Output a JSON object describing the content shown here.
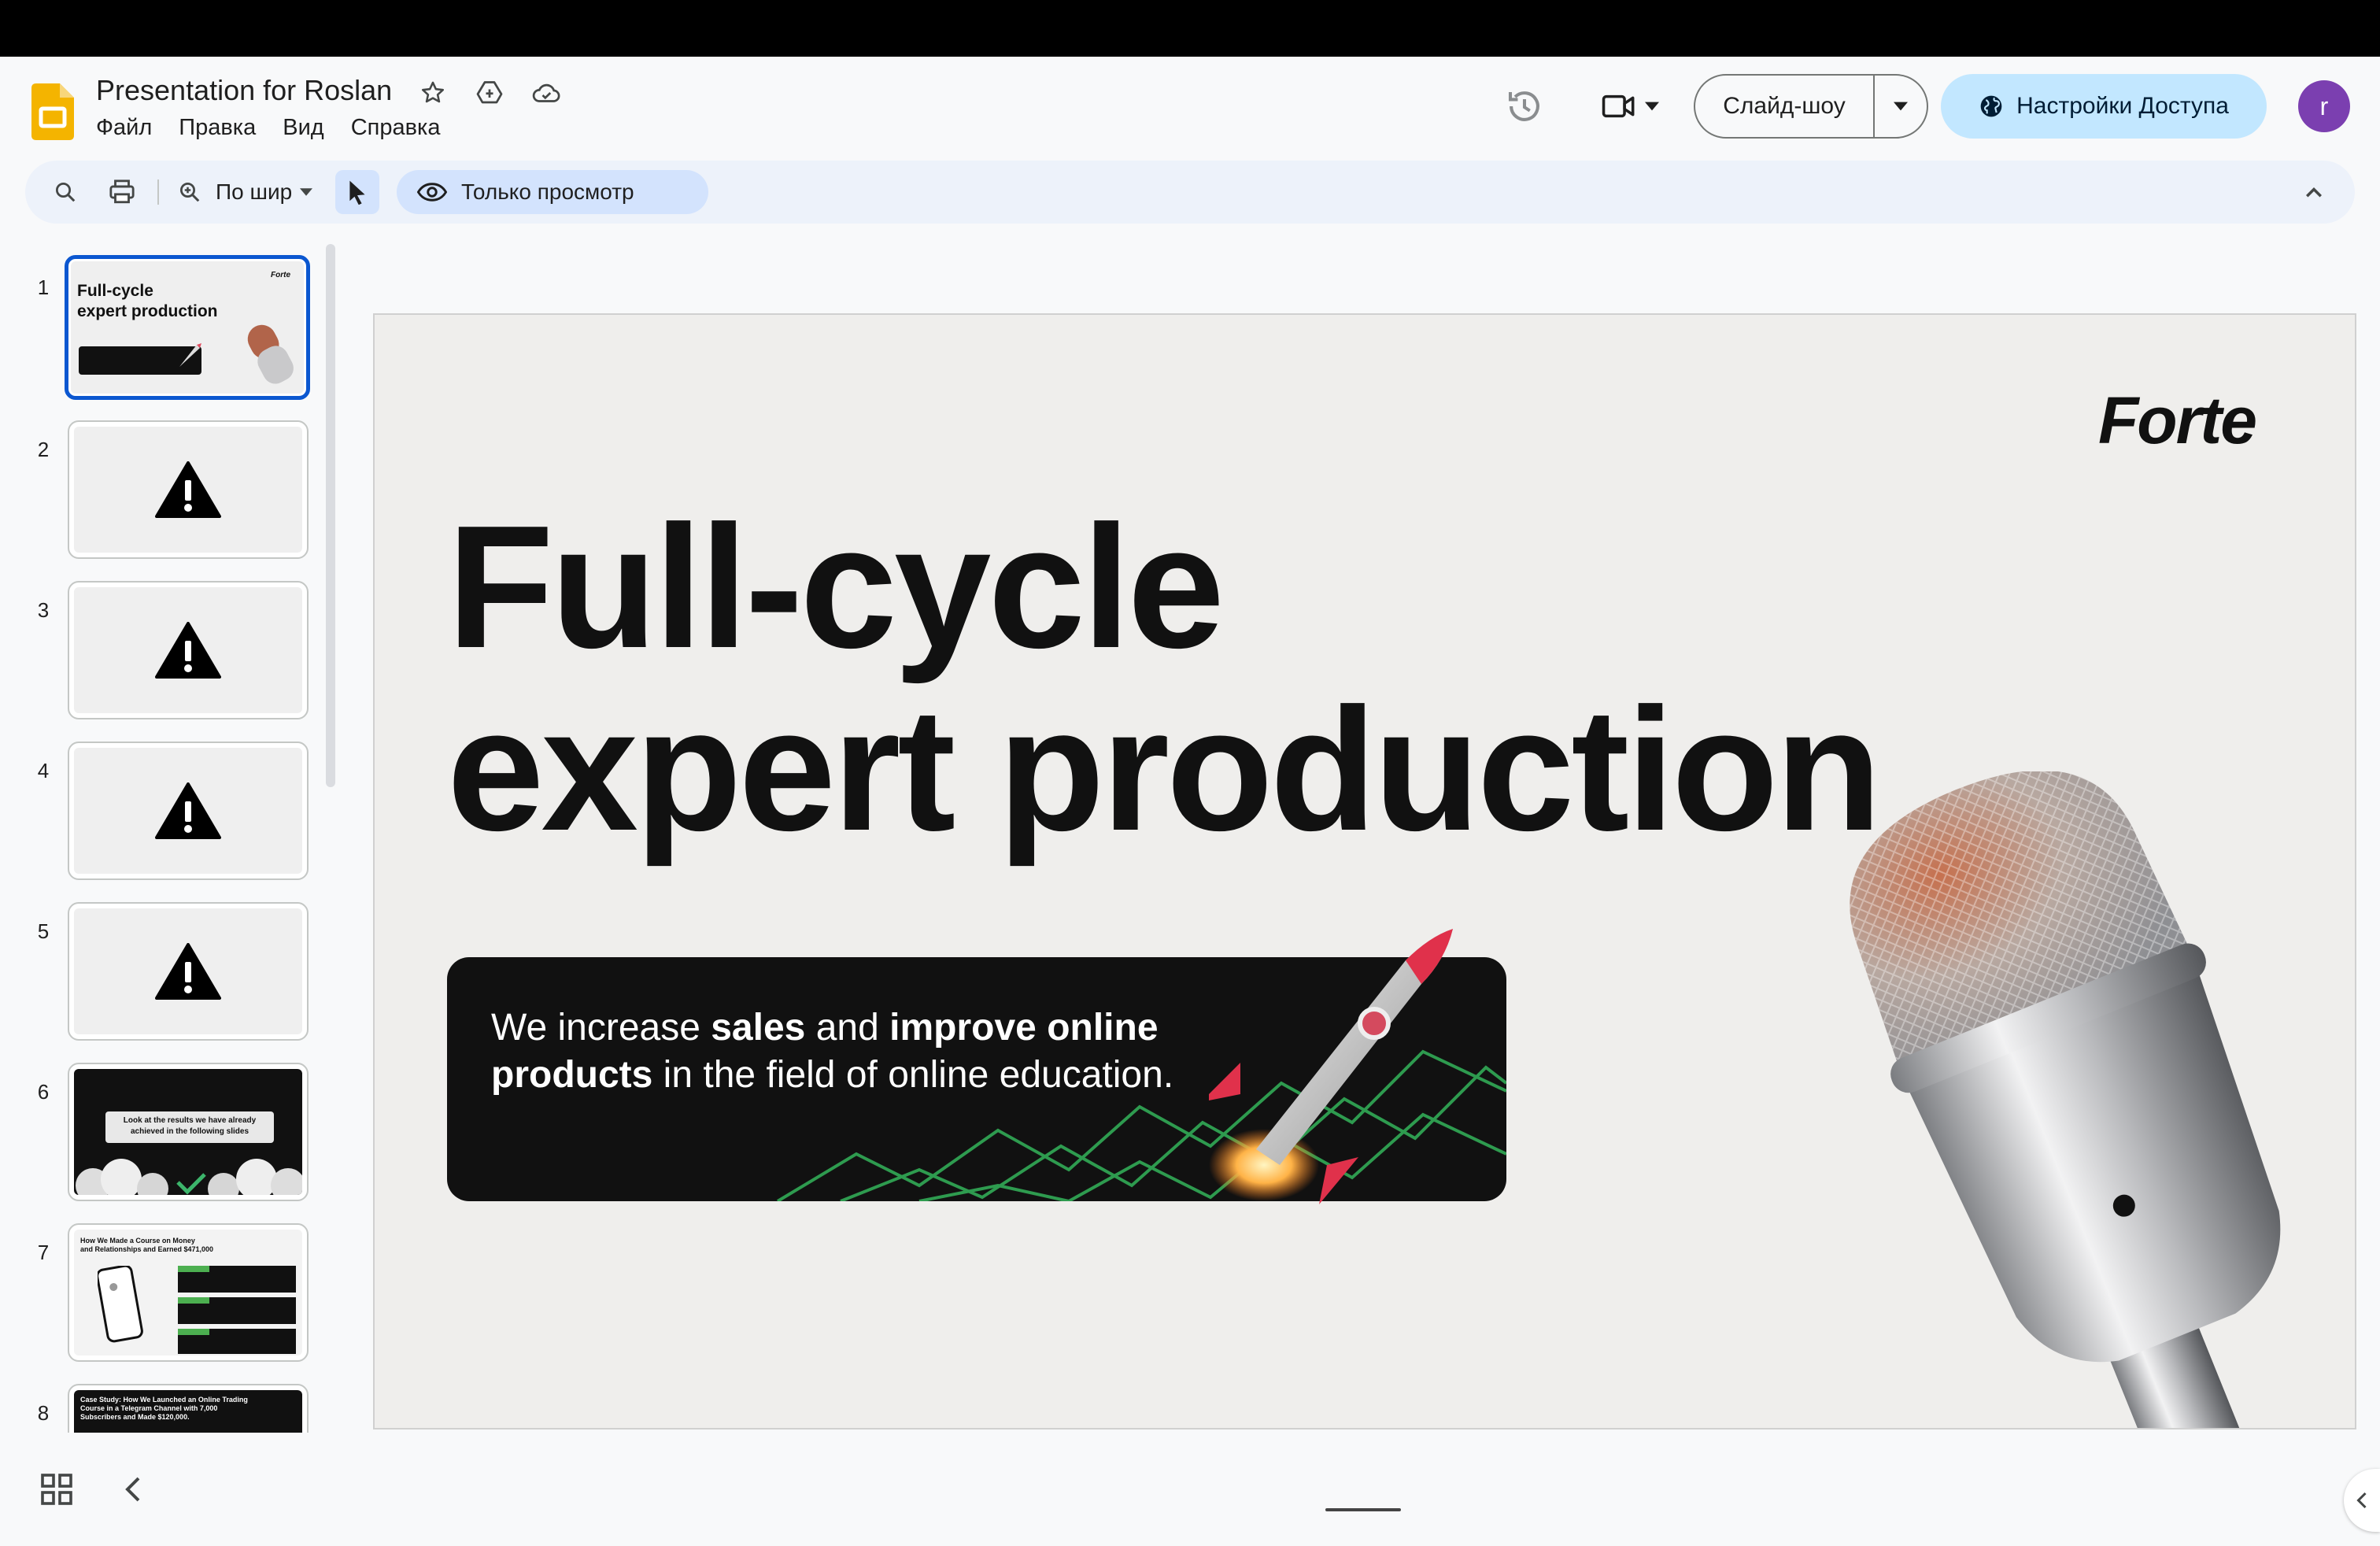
{
  "document": {
    "title": "Presentation for Roslan"
  },
  "menu": [
    "Файл",
    "Правка",
    "Вид",
    "Справка"
  ],
  "header": {
    "slideshow_label": "Слайд-шоу",
    "share_label": "Настройки Доступа",
    "avatar_letter": "r"
  },
  "toolbar": {
    "zoom_label": "По шир",
    "view_only_label": "Только просмотр"
  },
  "filmstrip": {
    "numbers": [
      "1",
      "2",
      "3",
      "4",
      "5",
      "6",
      "7",
      "8"
    ],
    "thumb1": {
      "title_line1": "Full-cycle",
      "title_line2": "expert production",
      "brand": "Forte"
    },
    "thumb6": {
      "text_line1": "Look at the results we have already",
      "text_line2": "achieved in the following slides"
    },
    "thumb7": {
      "title_line1": "How We Made a Course on Money",
      "title_line2": "and Relationships and Earned $471,000"
    },
    "thumb8": {
      "title_line1": "Case Study: How We Launched an Online Trading",
      "title_line2": "Course in a Telegram Channel with 7,000",
      "title_line3": "Subscribers and Made $120,000."
    }
  },
  "slide": {
    "brand": "Forte",
    "title_line1": "Full-cycle",
    "title_line2": "expert production",
    "banner": {
      "part1": "We increase ",
      "bold1": "sales",
      "part2": " and ",
      "bold2": "improve online products",
      "part3": " in the field of online education."
    }
  },
  "colors": {
    "accent": "#0b57d0",
    "share_button": "#c2e7ff",
    "avatar": "#7b3fb0",
    "slides_logo": "#f4b400"
  }
}
